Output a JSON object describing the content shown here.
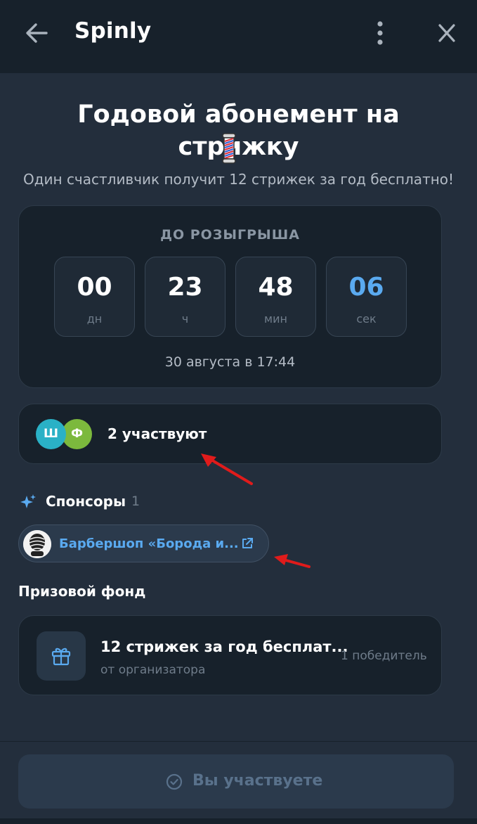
{
  "app": {
    "title": "Spinly"
  },
  "header": {
    "back_icon": "arrow-left-icon",
    "menu_icon": "more-vertical-icon",
    "close_icon": "close-icon"
  },
  "giveaway": {
    "title": "Годовой абонемент на стрижку",
    "title_emoji": "barber-pole-emoji",
    "description": "Один счастливчик получит 12 стрижек за год бесплатно!"
  },
  "countdown": {
    "label": "ДО РОЗЫГРЫША",
    "units": [
      {
        "value": "00",
        "unit": "дн"
      },
      {
        "value": "23",
        "unit": "ч"
      },
      {
        "value": "48",
        "unit": "мин"
      },
      {
        "value": "06",
        "unit": "сек"
      }
    ],
    "draw_date": "30 августа в 17:44"
  },
  "participants": {
    "avatars": [
      "Ш",
      "Ф"
    ],
    "count_text": "2 участвуют"
  },
  "sponsors": {
    "title": "Спонсоры",
    "count": "1",
    "items": [
      {
        "name": "Барбершоп «Борода и..."
      }
    ]
  },
  "prize_fund": {
    "title": "Призовой фонд",
    "items": [
      {
        "name": "12 стрижек за год бесплат...",
        "source": "от организатора",
        "winners": "1 победитель"
      }
    ]
  },
  "cta": {
    "label": "Вы участвуете"
  },
  "colors": {
    "accent": "#5aaaf0",
    "background": "#232e3c",
    "card": "#17212b",
    "avatar_sh": "#2ab1c6",
    "avatar_f": "#7cb93d",
    "annotation_arrow": "#e01b1b"
  }
}
